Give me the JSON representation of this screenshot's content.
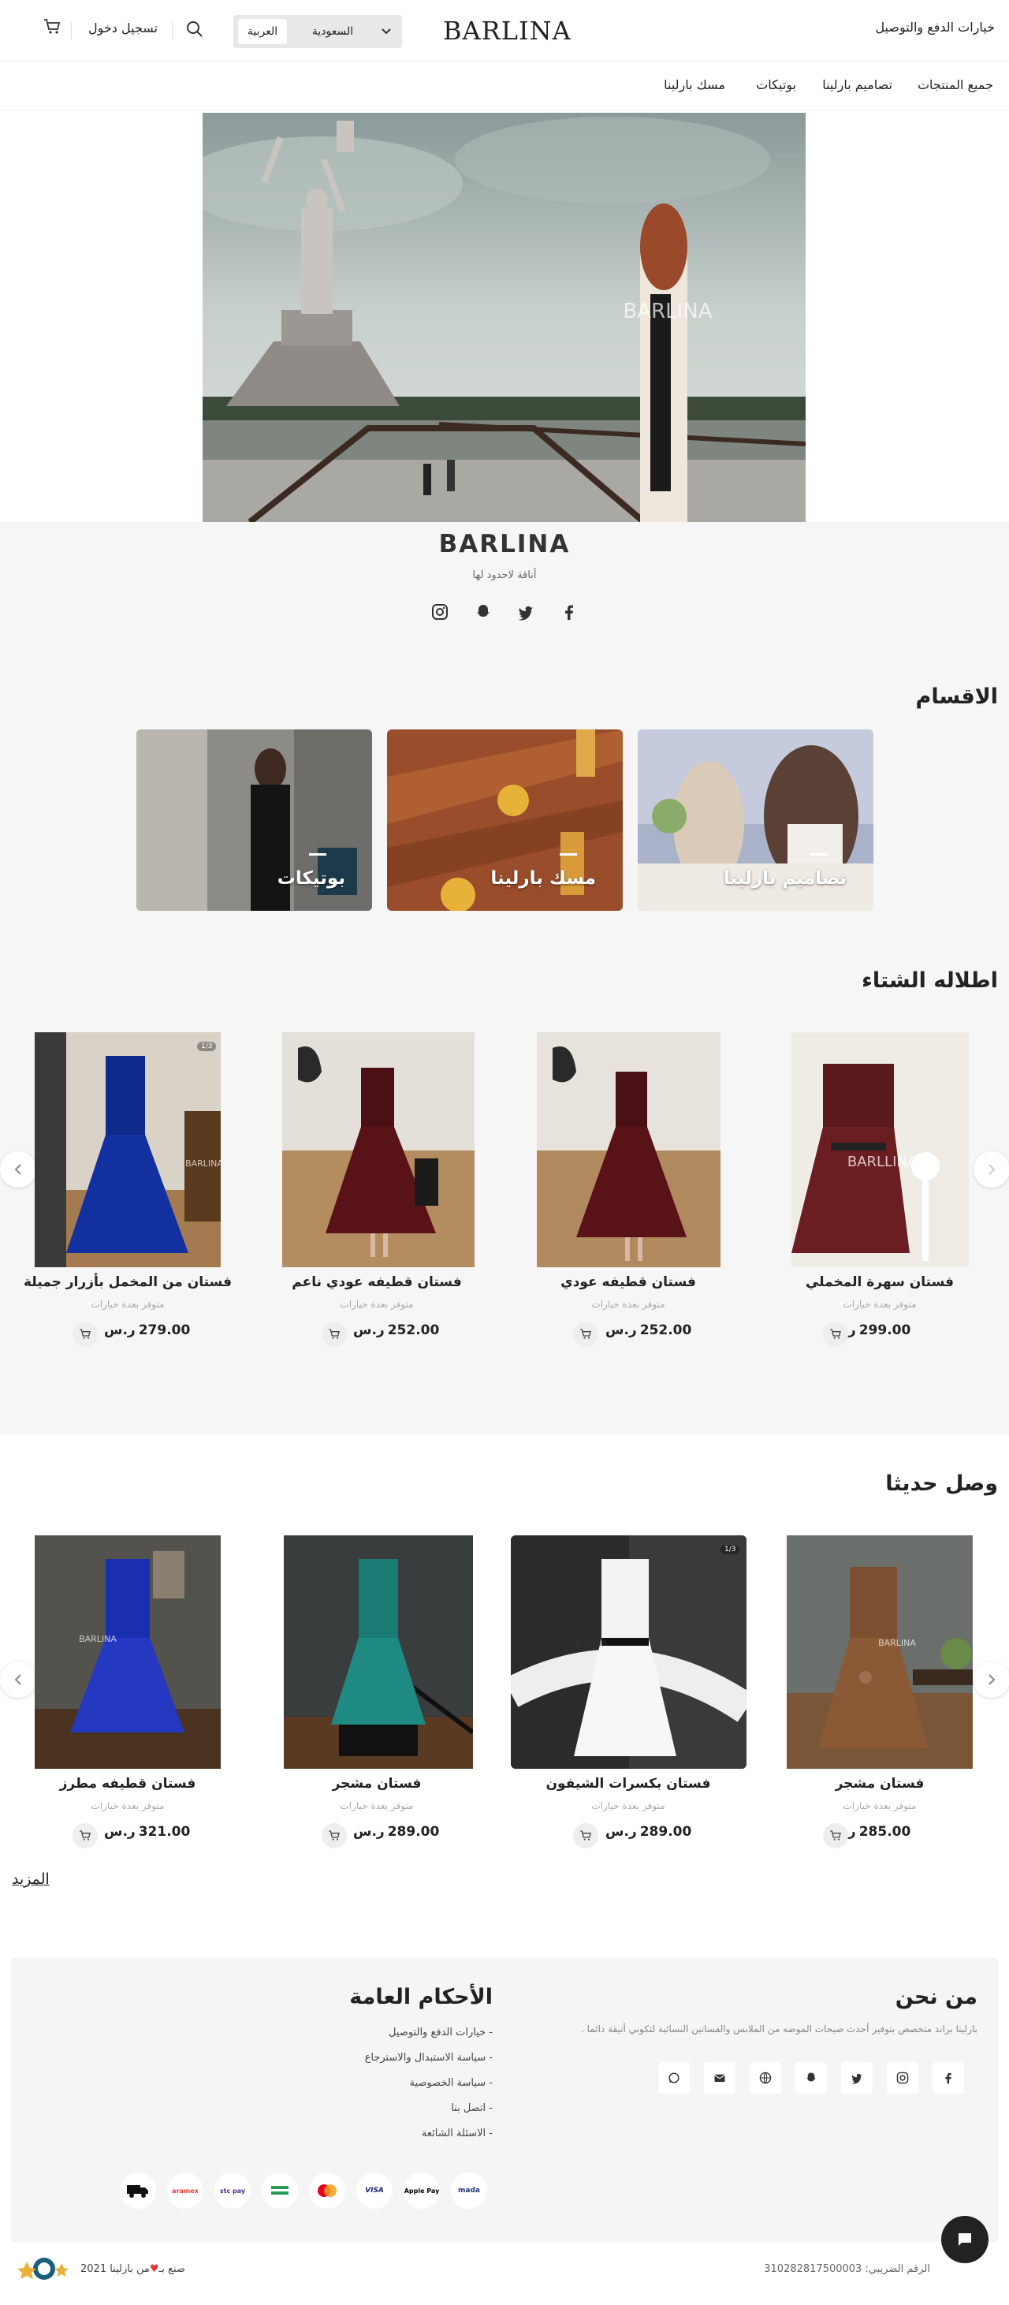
{
  "header": {
    "shipping_link": "خيارات الدفع والتوصيل",
    "logo": "BARLINA",
    "language": "العربية",
    "country": "السعودية",
    "login": "تسجيل دخول"
  },
  "nav": {
    "items": [
      "جميع المنتجات",
      "تصاميم بارلينا",
      "بوتيكات",
      "مسك بارلينا"
    ]
  },
  "hero": {
    "watermark": "BARLINA"
  },
  "brand": {
    "name": "BARLINA",
    "tagline": "أناقة لاحدود لها",
    "social_icons": [
      "instagram-icon",
      "snapchat-icon",
      "twitter-icon",
      "facebook-icon"
    ]
  },
  "categories": {
    "title": "الاقسام",
    "items": [
      {
        "label": "تصاميم بارلينا"
      },
      {
        "label": "مسك بارلينا"
      },
      {
        "label": "بوتيكات"
      }
    ]
  },
  "winter": {
    "title": "اطلاله الشتاء",
    "products": [
      {
        "name": "فستان سهرة المخملي",
        "availability": "متوفر بعدة خيارات",
        "price": "299.00",
        "currency": "ر.س"
      },
      {
        "name": "فستان قطيفه عودي",
        "availability": "متوفر بعدة خيارات",
        "price": "252.00",
        "currency": "ر.س"
      },
      {
        "name": "فستان قطيفه عودي ناعم",
        "availability": "متوفر بعدة خيارات",
        "price": "252.00",
        "currency": "ر.س"
      },
      {
        "name": "فستان من المخمل بأزرار جميلة",
        "availability": "متوفر بعدة خيارات",
        "price": "279.00",
        "currency": "ر.س",
        "badge": "1/3"
      }
    ]
  },
  "new_arrivals": {
    "title": "وصل حديثا",
    "products": [
      {
        "name": "فستان مشجر",
        "availability": "متوفر بعدة خيارات",
        "price": "285.00",
        "currency": "ر.س"
      },
      {
        "name": "فستان بكسرات الشيفون",
        "availability": "متوفر بعدة خيارات",
        "price": "289.00",
        "currency": "ر.س",
        "badge": "1/3"
      },
      {
        "name": "فستان مشجر",
        "availability": "متوفر بعدة خيارات",
        "price": "289.00",
        "currency": "ر.س"
      },
      {
        "name": "فستان قطيفه مطرز",
        "availability": "متوفر بعدة خيارات",
        "price": "321.00",
        "currency": "ر.س"
      }
    ],
    "more": "المزيد"
  },
  "footer": {
    "about_title": "من نحن",
    "about_text": "بارلينا براند متخصص بتوفير أحدث صيحات الموضه من الملابس والفساتين النسائية لتكوني أنيقة دائما .",
    "terms_title": "الأحكام العامة",
    "links": [
      "خيارات الدفع والتوصيل",
      "سياسة الاستبدال والاسترجاع",
      "سياسة الخصوصية",
      "اتصل بنا",
      "الاسئلة الشائعة"
    ],
    "payments": [
      "mada",
      "Apple Pay",
      "VISA",
      "mastercard",
      "bank-transfer",
      "stc pay",
      "aramex",
      "cod"
    ],
    "made_with": "صنع بـ",
    "made_by": "من بارلينا 2021",
    "tax_label": "الرقم الضريبي:",
    "tax_number": "310282817500003"
  },
  "colors": {
    "accent": "#222222",
    "band": "#f6f6f6",
    "heart": "#e53935"
  }
}
